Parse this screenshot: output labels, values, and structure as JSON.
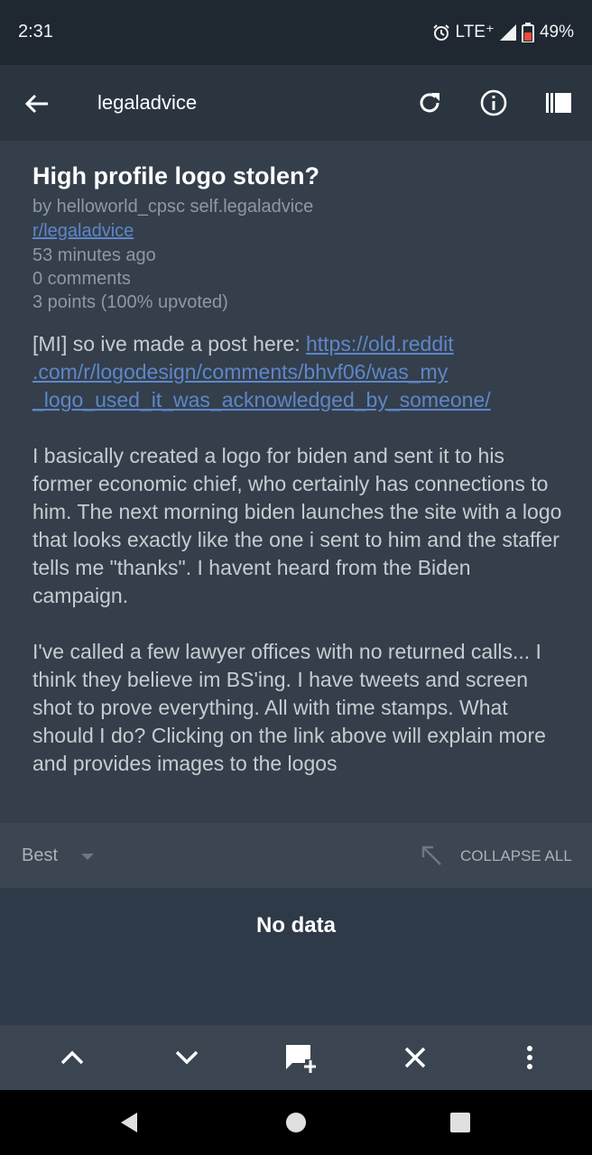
{
  "status": {
    "time": "2:31",
    "network": "LTE⁺",
    "battery": "49%"
  },
  "app_bar": {
    "title": "legaladvice"
  },
  "post": {
    "title": "High profile logo stolen?",
    "byline": "by helloworld_cpsc self.legaladvice",
    "subreddit": "r/legaladvice",
    "age": "53 minutes ago",
    "comments": "0 comments",
    "points": "3 points (100% upvoted)",
    "body_intro": "[MI] so ive made a post here: ",
    "body_link": "https://old.reddit.com/r/logodesign/comments/bhvf06/was_my_logo_used_it_was_acknowledged_by_someone/",
    "body_link_lines": [
      "https://old.reddit",
      ".com/r/logodesign/comments/bhvf06/was_my",
      "_logo_used_it_was_acknowledged_by_someone/"
    ],
    "paragraph2": "I basically created a logo for biden and sent it to his former economic chief, who certainly has connections to him. The next morning biden launches the site with a logo that looks exactly like the one i sent to him and the staffer tells me \"thanks\". I havent heard from the Biden campaign.",
    "paragraph3": "I've called a few lawyer offices with no returned calls... I think they believe im BS'ing. I have tweets and screen shot to prove everything. All with time stamps. What should I do? Clicking on the link above will explain more and provides images to the logos"
  },
  "sort_bar": {
    "sort": "Best",
    "collapse_all": "COLLAPSE ALL"
  },
  "comments": {
    "empty": "No data"
  },
  "colors": {
    "accent_link": "#5f86c9",
    "background": "#2e3a47",
    "post_bg": "#343f4b"
  },
  "icons": {
    "app_bar": [
      "back-arrow-icon",
      "refresh-icon",
      "info-icon",
      "sidebar-icon"
    ],
    "bottom_bar": [
      "chevron-up-icon",
      "chevron-down-icon",
      "add-comment-icon",
      "close-icon",
      "more-vert-icon"
    ],
    "nav": [
      "back-triangle-icon",
      "home-circle-icon",
      "recents-square-icon"
    ]
  }
}
